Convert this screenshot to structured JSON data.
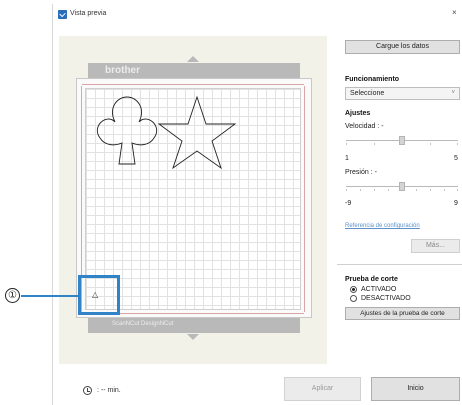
{
  "window": {
    "title": "Vista previa",
    "close_glyph": "×",
    "icon": "scanncut-app-icon"
  },
  "preview": {
    "brand_top": "brother",
    "brand_bottom": "ScanNCut  DesignNCut",
    "origin_marker": "△",
    "shapes": [
      "club",
      "star"
    ]
  },
  "callout": {
    "number": "①",
    "color": "#2f83c6"
  },
  "panel": {
    "load_button": "Cargue los datos",
    "operation_header": "Funcionamiento",
    "operation_select": "Seleccione",
    "settings_header": "Ajustes",
    "speed_label": "Velocidad : -",
    "speed_min": "1",
    "speed_max": "5",
    "pressure_label": "Presión : -",
    "pressure_min": "-9",
    "pressure_max": "9",
    "config_link": "Referencia de configuración",
    "more_button": "Más...",
    "test_cut_header": "Prueba de corte",
    "test_cut_on": "ACTIVADO",
    "test_cut_off": "DESACTIVADO",
    "test_cut_selected": "ACTIVADO",
    "test_cut_settings_button": "Ajustes de la prueba de corte"
  },
  "footer": {
    "time_text": ":  -- min.",
    "apply_button": "Aplicar",
    "start_button": "Inicio"
  }
}
